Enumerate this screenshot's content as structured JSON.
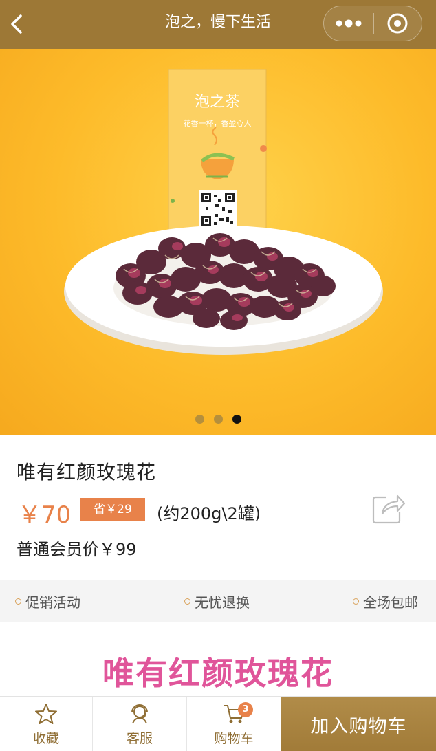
{
  "nav": {
    "title": "泡之，慢下生活",
    "back_icon": "chevron-left-icon",
    "more_icon": "more-dots-icon",
    "close_icon": "target-close-icon"
  },
  "banner": {
    "package_brand": "泡之茶",
    "package_slogan": "花香一杯，香盈心人",
    "dots_count": 3,
    "active_dot": 2
  },
  "product": {
    "name": "唯有红颜玫瑰花",
    "price": "￥70",
    "save_badge": "省￥29",
    "spec": "(约200g\\2罐)",
    "member_price": "普通会员价￥99",
    "share_icon": "share-icon"
  },
  "services": [
    {
      "label": "促销活动"
    },
    {
      "label": "无忧退换"
    },
    {
      "label": "全场包邮"
    }
  ],
  "detail": {
    "title": "唯有红颜玫瑰花"
  },
  "bottom": {
    "favorite_label": "收藏",
    "service_label": "客服",
    "cart_label": "购物车",
    "cart_count": "3",
    "add_to_cart": "加入购物车"
  },
  "colors": {
    "nav_bg": "#9d7836",
    "accent": "#e8824a",
    "gold": "#8f6e34",
    "detail_title": "#e0559a"
  }
}
